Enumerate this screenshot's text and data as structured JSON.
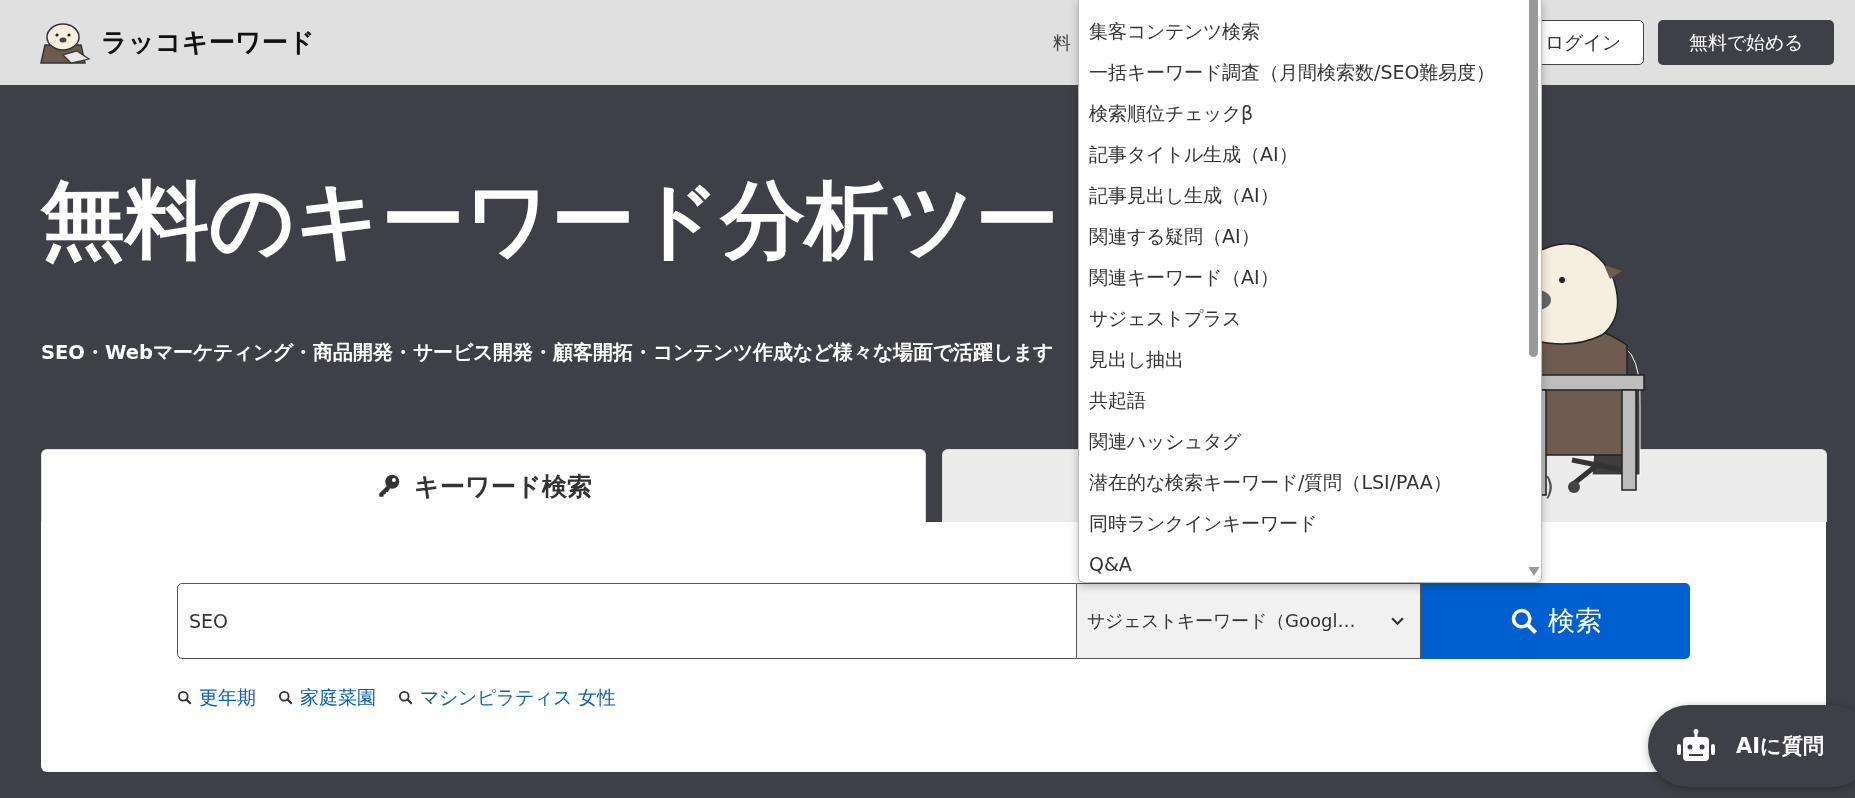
{
  "header": {
    "logo_text": "ラッコキーワード",
    "nav_fragment": "料",
    "login_button": "ログイン",
    "start_button": "無料で始める"
  },
  "hero": {
    "title": "無料のキーワード分析ツー",
    "subtitle": "SEO・Webマーケティング・商品開発・サービス開発・顧客開拓・コンテンツ作成など様々な場面で活躍します"
  },
  "tabs": [
    {
      "label": "キーワード検索",
      "selected": true
    },
    {
      "label": ")",
      "selected": false
    }
  ],
  "search": {
    "value": "SEO",
    "mode": "サジェストキーワード（Googl…",
    "button": "検索"
  },
  "suggestions": [
    "更年期",
    "家庭菜園",
    "マシンピラティス 女性"
  ],
  "dropdown": {
    "expanded": true,
    "options": [
      {
        "label": "集客コンテンツ検索"
      },
      {
        "label": "一括キーワード調査（月間検索数/SEO難易度）"
      },
      {
        "label": "検索順位チェックβ"
      },
      {
        "label": "記事タイトル生成（AI）"
      },
      {
        "label": "記事見出し生成（AI）"
      },
      {
        "label": "関連する疑問（AI）"
      },
      {
        "label": "関連キーワード（AI）"
      },
      {
        "label": "サジェストプラス"
      },
      {
        "label": "見出し抽出"
      },
      {
        "label": "共起語"
      },
      {
        "label": "関連ハッシュタグ"
      },
      {
        "label": "潜在的な検索キーワード/質問（LSI/PAA）"
      },
      {
        "label": "同時ランクインキーワード"
      },
      {
        "label": "Q&A"
      }
    ]
  },
  "ai_button": "AIに質問"
}
